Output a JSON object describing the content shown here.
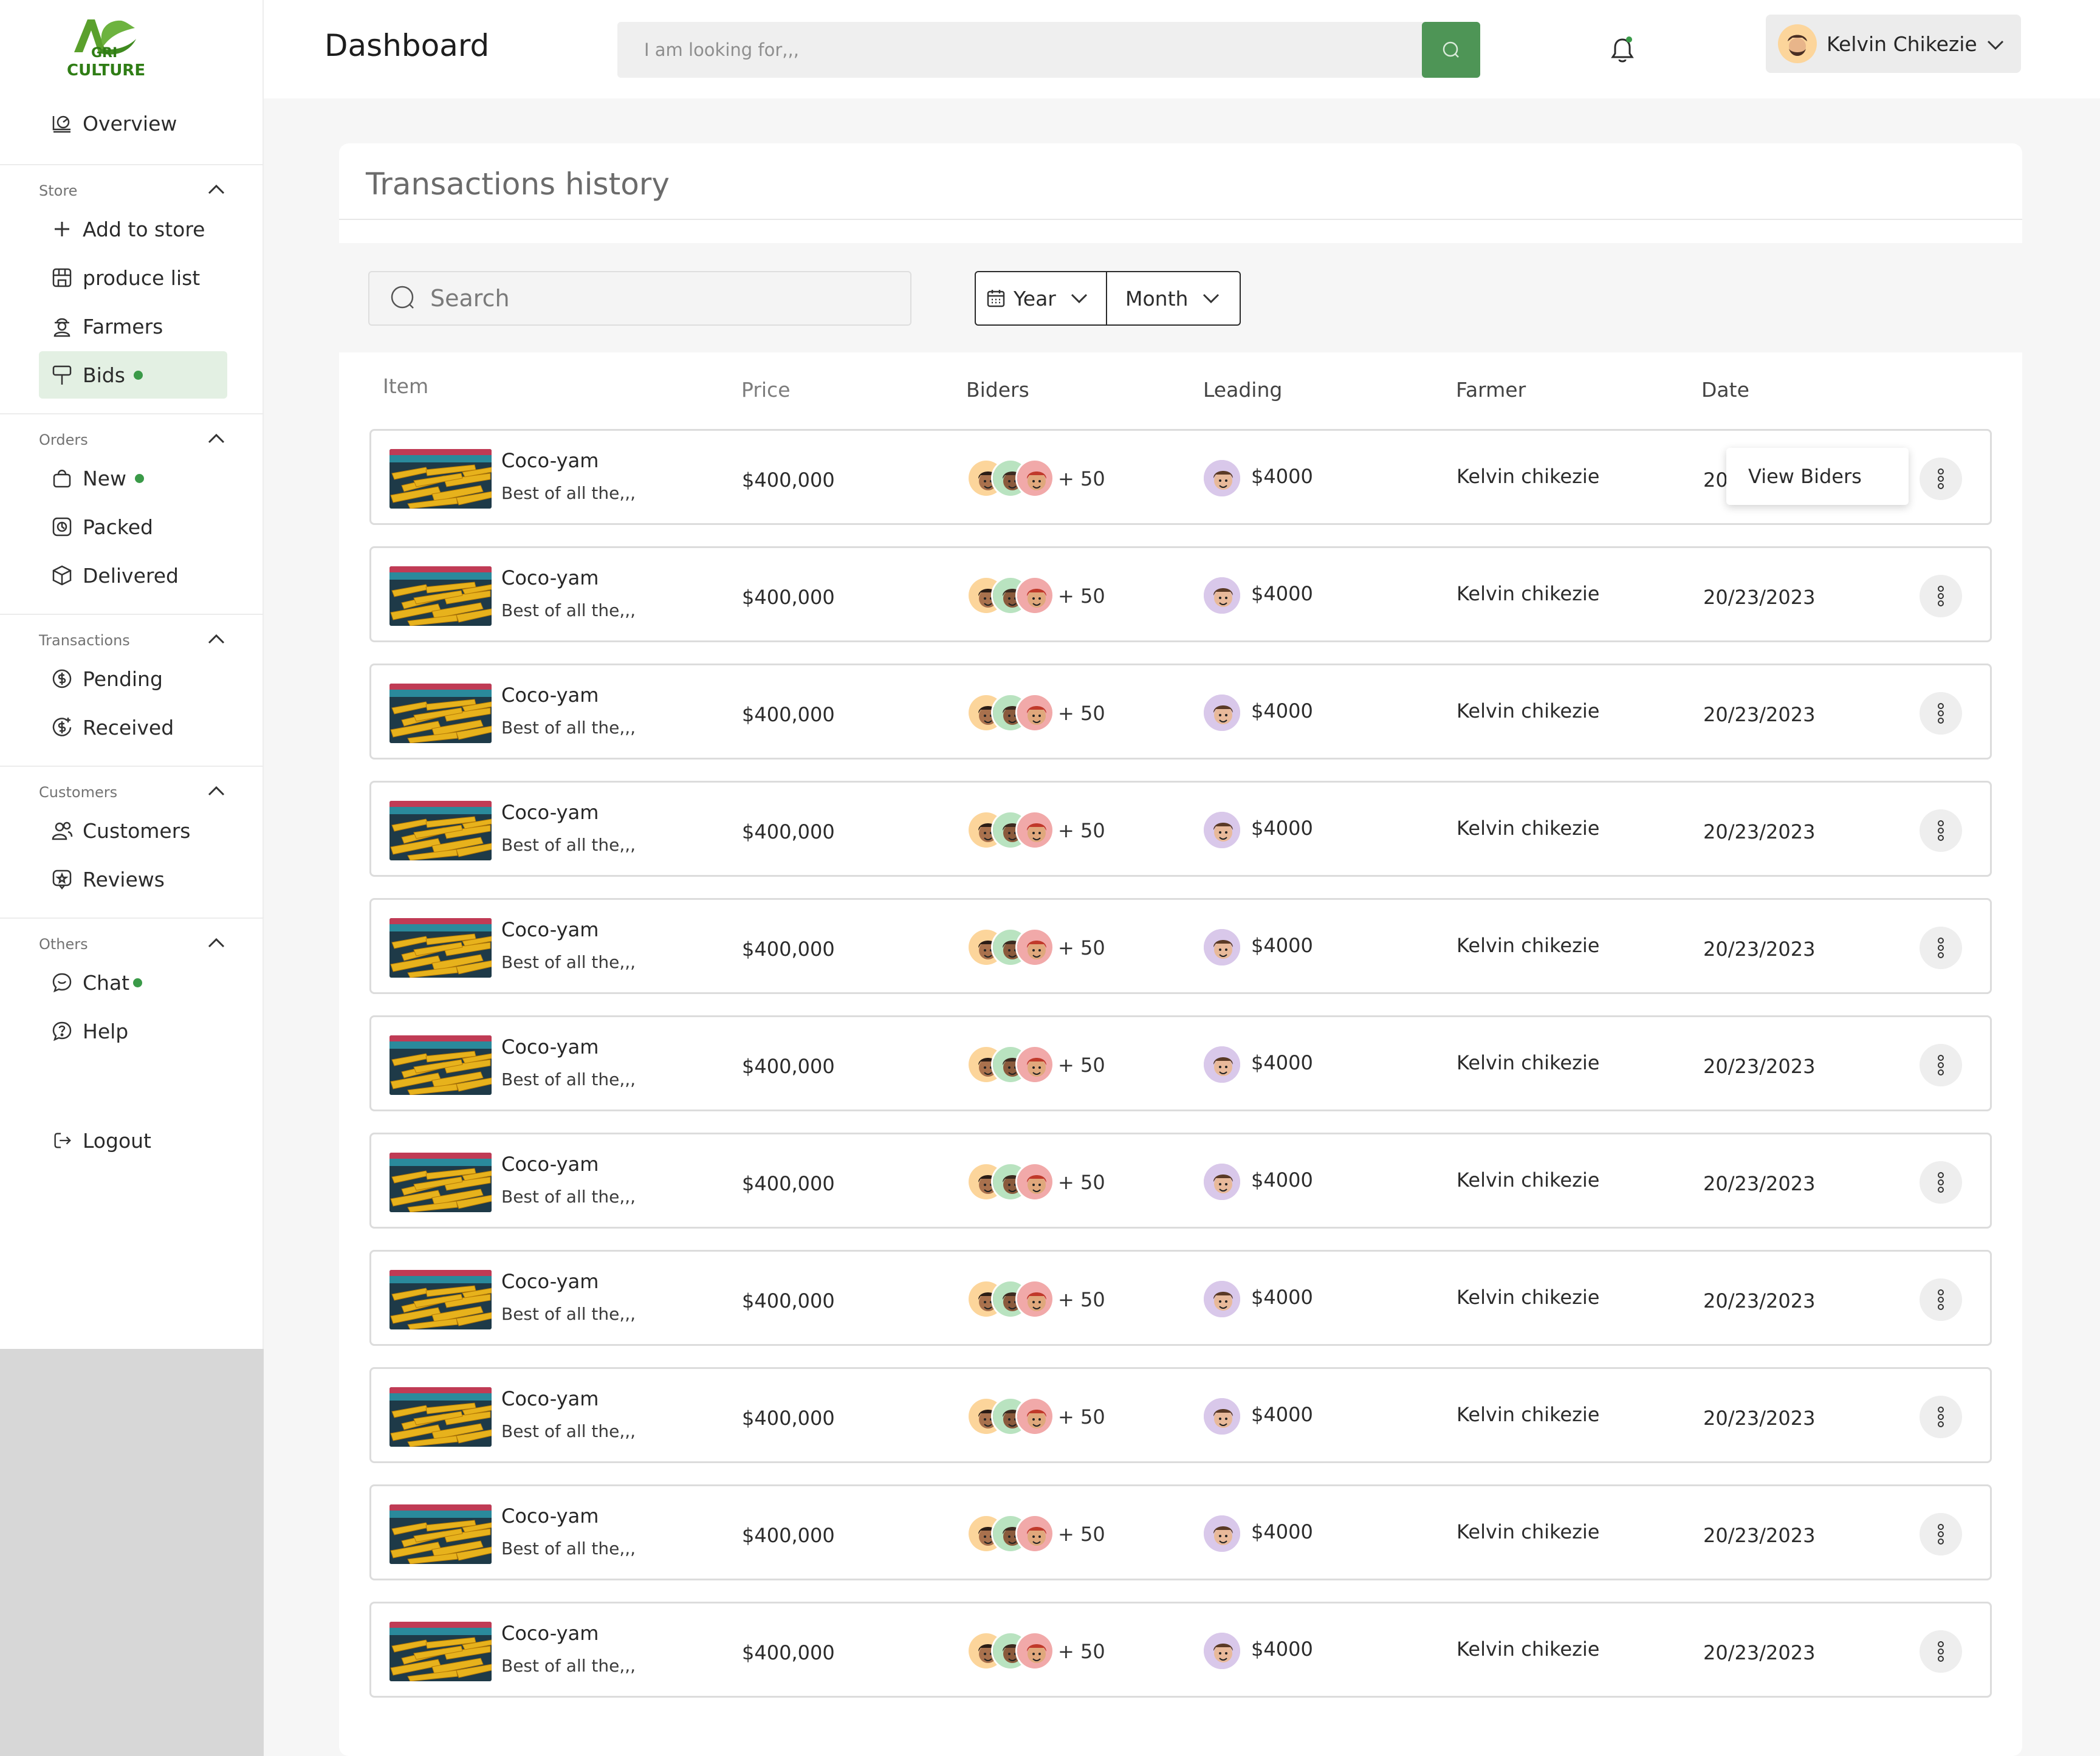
{
  "brand": {
    "logo_text": "CULTURE",
    "logo_small": "GRI"
  },
  "sidebar": {
    "overview": "Overview",
    "sections": [
      {
        "title": "Store",
        "items": [
          {
            "label": "Add to store",
            "icon": "plus-icon"
          },
          {
            "label": "produce list",
            "icon": "store-icon"
          },
          {
            "label": "Farmers",
            "icon": "farmer-icon"
          },
          {
            "label": "Bids",
            "icon": "bid-icon",
            "active": true,
            "dot": true
          }
        ]
      },
      {
        "title": "Orders",
        "items": [
          {
            "label": "New",
            "icon": "bag-icon",
            "dot": true
          },
          {
            "label": "Packed",
            "icon": "package-icon"
          },
          {
            "label": "Delivered",
            "icon": "box-icon"
          }
        ]
      },
      {
        "title": "Transactions",
        "items": [
          {
            "label": "Pending",
            "icon": "coin-pending-icon"
          },
          {
            "label": "Received",
            "icon": "coin-received-icon"
          }
        ]
      },
      {
        "title": "Customers",
        "items": [
          {
            "label": "Customers",
            "icon": "users-icon"
          },
          {
            "label": "Reviews",
            "icon": "review-icon"
          }
        ]
      },
      {
        "title": "Others",
        "items": [
          {
            "label": "Chat",
            "icon": "chat-icon",
            "dot": true
          },
          {
            "label": "Help",
            "icon": "help-icon"
          }
        ]
      }
    ],
    "logout": "Logout"
  },
  "header": {
    "title": "Dashboard",
    "search_placeholder": "I am looking for,,,",
    "user_name": "Kelvin Chikezie"
  },
  "panel": {
    "title": "Transactions history",
    "search_placeholder": "Search",
    "year_label": "Year",
    "month_label": "Month",
    "columns": [
      "Item",
      "Price",
      "Biders",
      "Leading",
      "Farmer",
      "Date"
    ],
    "popup_label": "View Biders"
  },
  "rows": [
    {
      "name": "Coco-yam",
      "desc": "Best of all the,,,",
      "price": "$400,000",
      "biders_more": "+ 50",
      "leading": "$4000",
      "farmer": "Kelvin chikezie",
      "date": "20/23/2023"
    },
    {
      "name": "Coco-yam",
      "desc": "Best of all the,,,",
      "price": "$400,000",
      "biders_more": "+ 50",
      "leading": "$4000",
      "farmer": "Kelvin chikezie",
      "date": "20/23/2023"
    },
    {
      "name": "Coco-yam",
      "desc": "Best of all the,,,",
      "price": "$400,000",
      "biders_more": "+ 50",
      "leading": "$4000",
      "farmer": "Kelvin chikezie",
      "date": "20/23/2023"
    },
    {
      "name": "Coco-yam",
      "desc": "Best of all the,,,",
      "price": "$400,000",
      "biders_more": "+ 50",
      "leading": "$4000",
      "farmer": "Kelvin chikezie",
      "date": "20/23/2023"
    },
    {
      "name": "Coco-yam",
      "desc": "Best of all the,,,",
      "price": "$400,000",
      "biders_more": "+ 50",
      "leading": "$4000",
      "farmer": "Kelvin chikezie",
      "date": "20/23/2023"
    },
    {
      "name": "Coco-yam",
      "desc": "Best of all the,,,",
      "price": "$400,000",
      "biders_more": "+ 50",
      "leading": "$4000",
      "farmer": "Kelvin chikezie",
      "date": "20/23/2023"
    },
    {
      "name": "Coco-yam",
      "desc": "Best of all the,,,",
      "price": "$400,000",
      "biders_more": "+ 50",
      "leading": "$4000",
      "farmer": "Kelvin chikezie",
      "date": "20/23/2023"
    },
    {
      "name": "Coco-yam",
      "desc": "Best of all the,,,",
      "price": "$400,000",
      "biders_more": "+ 50",
      "leading": "$4000",
      "farmer": "Kelvin chikezie",
      "date": "20/23/2023"
    },
    {
      "name": "Coco-yam",
      "desc": "Best of all the,,,",
      "price": "$400,000",
      "biders_more": "+ 50",
      "leading": "$4000",
      "farmer": "Kelvin chikezie",
      "date": "20/23/2023"
    },
    {
      "name": "Coco-yam",
      "desc": "Best of all the,,,",
      "price": "$400,000",
      "biders_more": "+ 50",
      "leading": "$4000",
      "farmer": "Kelvin chikezie",
      "date": "20/23/2023"
    },
    {
      "name": "Coco-yam",
      "desc": "Best of all the,,,",
      "price": "$400,000",
      "biders_more": "+ 50",
      "leading": "$4000",
      "farmer": "Kelvin chikezie",
      "date": "20/23/2023"
    }
  ],
  "colors": {
    "accent": "#4e9556",
    "active_bg": "#e3f0e3",
    "dot": "#3a9a48"
  }
}
